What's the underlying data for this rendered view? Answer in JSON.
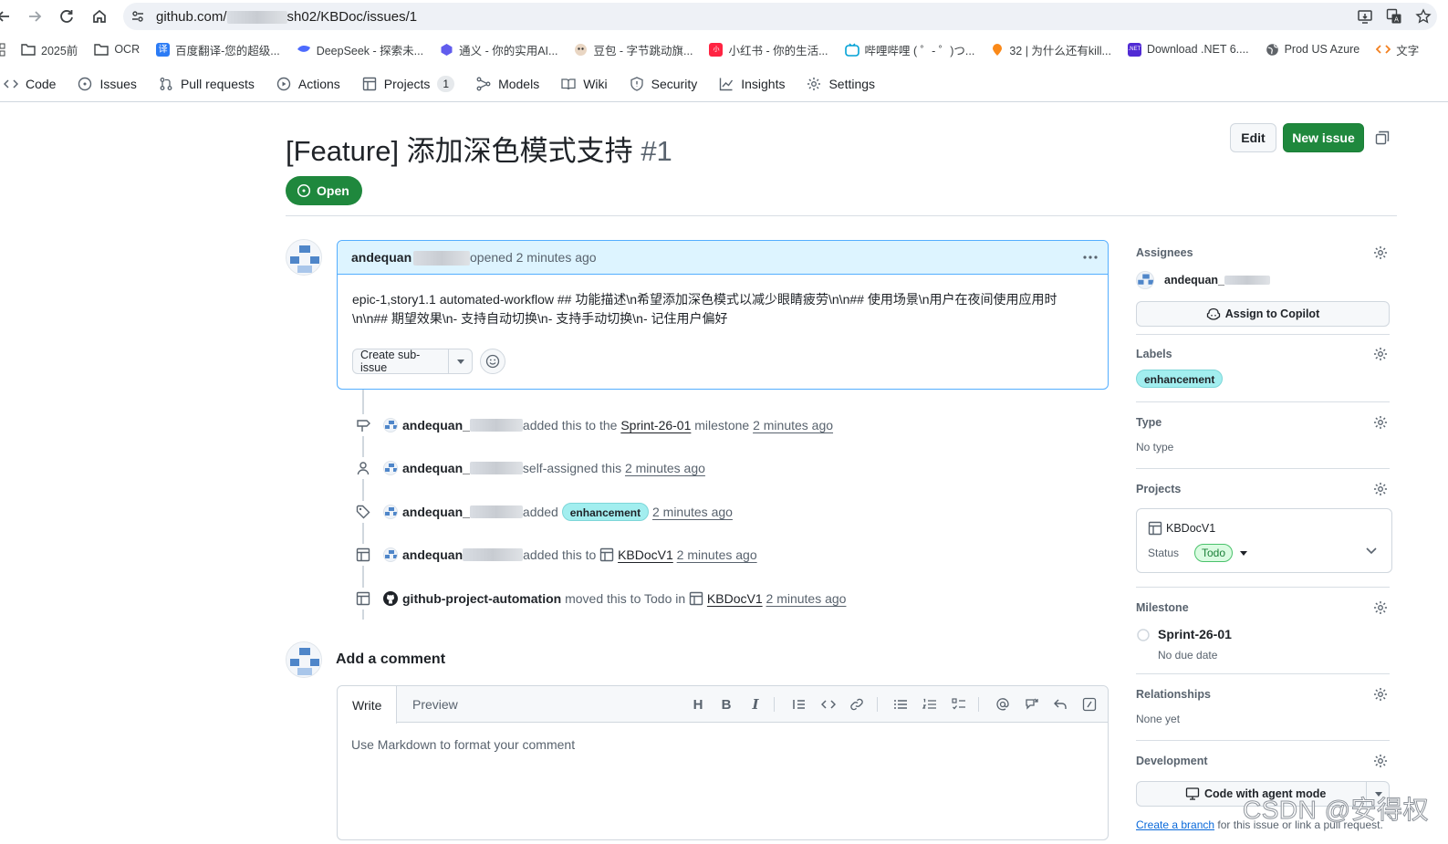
{
  "browser": {
    "url_prefix": "github.com/",
    "url_suffix": "sh02/KBDoc/issues/1",
    "bookmarks": [
      {
        "label": "2025前",
        "icon": "folder-icon"
      },
      {
        "label": "OCR",
        "icon": "folder-icon"
      },
      {
        "label": "百度翻译-您的超级...",
        "icon": "baidu-translate-icon",
        "color": "#2b7bf5"
      },
      {
        "label": "DeepSeek - 探索未...",
        "icon": "deepseek-icon",
        "color": "#4d6bfe"
      },
      {
        "label": "通义 - 你的实用AI...",
        "icon": "tongyi-icon",
        "color": "#615ced"
      },
      {
        "label": "豆包 - 字节跳动旗...",
        "icon": "doubao-icon",
        "color": "#3a3a3a"
      },
      {
        "label": "小红书 - 你的生活...",
        "icon": "xiaohongshu-icon",
        "color": "#ff2442"
      },
      {
        "label": "哔哩哔哩 ( ゜- ゜)つ...",
        "icon": "bilibili-icon",
        "color": "#00a1d6"
      },
      {
        "label": "32 | 为什么还有kill...",
        "icon": "geektime-icon",
        "color": "#fa8919"
      },
      {
        "label": "Download .NET 6....",
        "icon": "dotnet-icon",
        "color": "#512bd4"
      },
      {
        "label": "Prod US Azure",
        "icon": "globe-icon",
        "color": "#5f6368"
      },
      {
        "label": "文字",
        "icon": "code-icon",
        "color": "#f38020"
      }
    ]
  },
  "repo_nav": {
    "tabs": [
      {
        "label": "Code",
        "name": "code"
      },
      {
        "label": "Issues",
        "name": "issues"
      },
      {
        "label": "Pull requests",
        "name": "pull-requests"
      },
      {
        "label": "Actions",
        "name": "actions"
      },
      {
        "label": "Projects",
        "name": "projects",
        "count": "1"
      },
      {
        "label": "Models",
        "name": "models"
      },
      {
        "label": "Wiki",
        "name": "wiki"
      },
      {
        "label": "Security",
        "name": "security"
      },
      {
        "label": "Insights",
        "name": "insights"
      },
      {
        "label": "Settings",
        "name": "settings"
      }
    ]
  },
  "issue": {
    "title": "[Feature] 添加深色模式支持",
    "number": "#1",
    "state": "Open",
    "edit_label": "Edit",
    "new_issue_label": "New issue"
  },
  "comment": {
    "author": "andequan",
    "meta": "opened 2 minutes ago",
    "body_line1": "epic-1,story1.1 automated-workflow ## 功能描述\\n希望添加深色模式以减少眼睛疲劳\\n\\n## 使用场景\\n用户在夜间使用应用时",
    "body_line2": "\\n\\n## 期望效果\\n- 支持自动切换\\n- 支持手动切换\\n- 记住用户偏好",
    "create_sub_issue": "Create sub-issue"
  },
  "timeline": [
    {
      "icon": "milestone-icon",
      "actor": "andequan_",
      "action": "added this to the",
      "link": "Sprint-26-01",
      "after": "milestone",
      "time": "2 minutes ago"
    },
    {
      "icon": "person-icon",
      "actor": "andequan_",
      "action": "self-assigned this",
      "time": "2 minutes ago"
    },
    {
      "icon": "tag-icon",
      "actor": "andequan_",
      "action": "added",
      "label": "enhancement",
      "time": "2 minutes ago"
    },
    {
      "icon": "table-icon",
      "actor": "andequan",
      "action": "added this to",
      "link": "KBDocV1",
      "time": "2 minutes ago"
    },
    {
      "icon": "table-icon",
      "actor": "github-project-automation",
      "action": "moved this to Todo in",
      "link": "KBDocV1",
      "time": "2 minutes ago"
    }
  ],
  "add_comment": {
    "heading": "Add a comment",
    "write_tab": "Write",
    "preview_tab": "Preview",
    "placeholder": "Use Markdown to format your comment"
  },
  "sidebar": {
    "assignees": {
      "heading": "Assignees",
      "user": "andequan_",
      "assign_copilot": "Assign to Copilot"
    },
    "labels": {
      "heading": "Labels",
      "label": "enhancement"
    },
    "type": {
      "heading": "Type",
      "value": "No type"
    },
    "projects": {
      "heading": "Projects",
      "project": "KBDocV1",
      "status_label": "Status",
      "status_value": "Todo"
    },
    "milestone": {
      "heading": "Milestone",
      "name": "Sprint-26-01",
      "due": "No due date"
    },
    "relationships": {
      "heading": "Relationships",
      "value": "None yet"
    },
    "development": {
      "heading": "Development",
      "button": "Code with agent mode",
      "link": "Create a branch",
      "rest": "for this issue or link a pull request."
    }
  },
  "watermark": "CSDN @安得权",
  "colors": {
    "accent_green": "#1f883d",
    "label_bg": "#a2eeef",
    "comment_head": "#ddf4ff",
    "todo_green": "#dafbe1"
  }
}
